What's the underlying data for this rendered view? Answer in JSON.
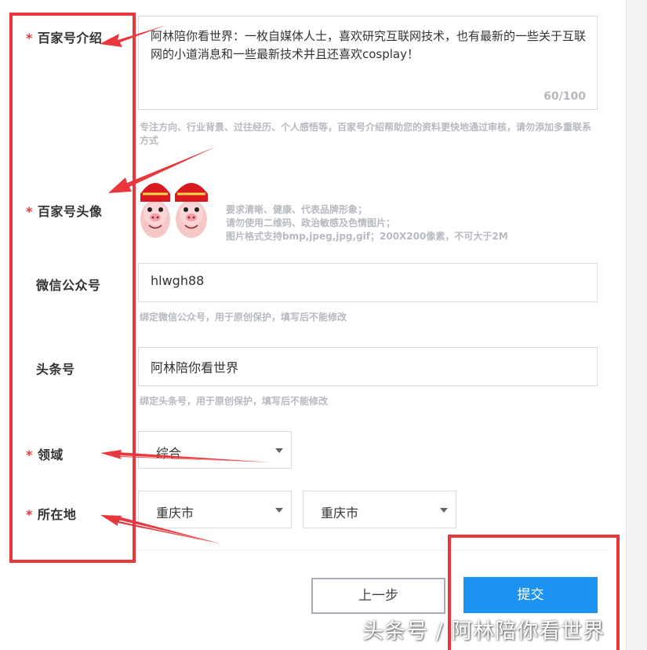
{
  "form": {
    "intro": {
      "label": "百家号介绍",
      "value": "阿林陪你看世界：一枚自媒体人士，喜欢研究互联网技术，也有最新的一些关于互联网的小道消息和一些最新技术并且还喜欢cosplay！",
      "counter": "60/100",
      "hint": "专注方向、行业背景、过往经历、个人感悟等，百家号介绍帮助您的资料更快地通过审核，请勿添加多重联系方式"
    },
    "avatar": {
      "label": "百家号头像",
      "hint_lines": [
        "要求清晰、健康、代表品牌形象；",
        "请勿使用二维码、政治敏感及色情图片；",
        "图片格式支持bmp,jpeg,jpg,gif；200X200像素，不可大于2M"
      ]
    },
    "wechat": {
      "label": "微信公众号",
      "value": "hlwgh88",
      "hint": "绑定微信公众号，用于原创保护，填写后不能修改"
    },
    "toutiao": {
      "label": "头条号",
      "value": "阿林陪你看世界",
      "hint": "绑定头条号，用于原创保护，填写后不能修改"
    },
    "domain": {
      "label": "领域",
      "value": "综合"
    },
    "location": {
      "label": "所在地",
      "province": "重庆市",
      "city": "重庆市"
    },
    "required_mark": "*"
  },
  "buttons": {
    "prev": "上一步",
    "submit": "提交"
  },
  "watermark": "头条号 / 阿林陪你看世界",
  "colors": {
    "accent": "#1c93f1",
    "annotation": "#e8383d"
  }
}
